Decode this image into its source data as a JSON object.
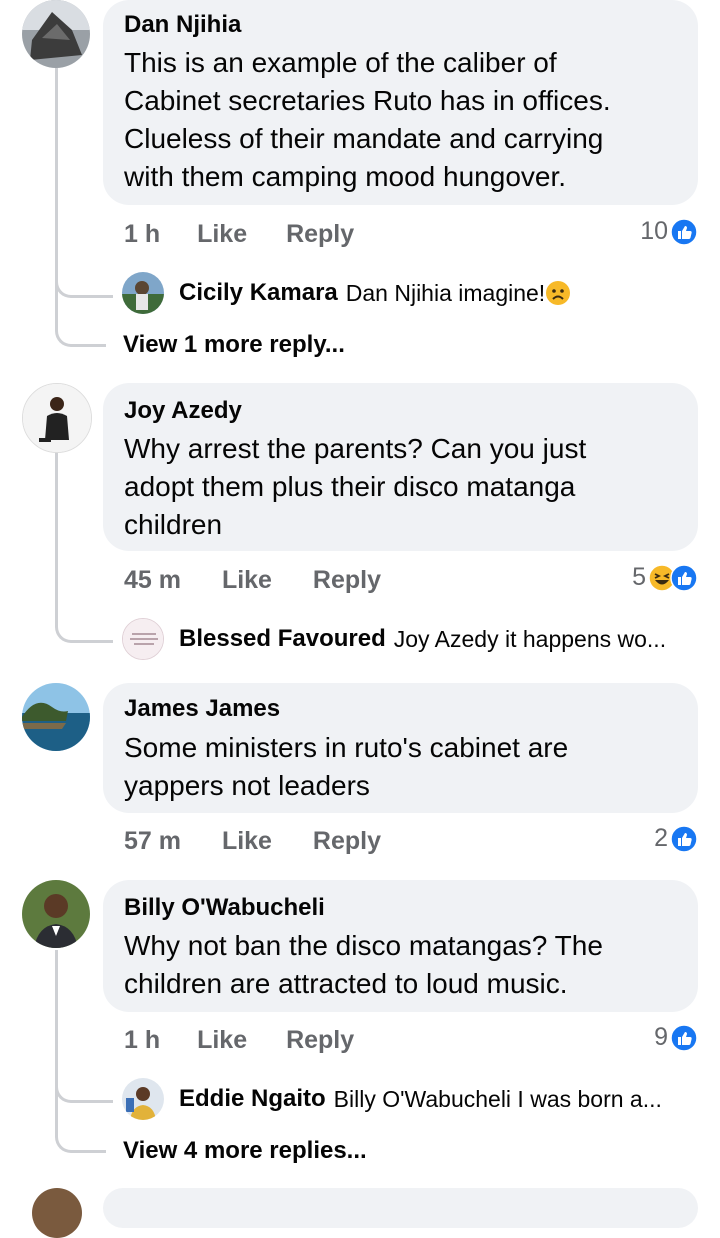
{
  "comments": [
    {
      "author": "Dan Njihia",
      "lines": [
        "This is an example of the caliber of",
        "Cabinet secretaries Ruto has in offices.",
        "Clueless of their mandate and carrying",
        "with them camping mood hungover."
      ],
      "time": "1 h",
      "like_label": "Like",
      "reply_label": "Reply",
      "reaction_count": "10",
      "reply_preview": {
        "author": "Cicily Kamara",
        "text": "Dan Njihia imagine!"
      },
      "more_replies": "View 1 more reply..."
    },
    {
      "author": "Joy Azedy",
      "lines": [
        "Why arrest the parents? Can you just",
        "adopt them plus their disco matanga",
        "children"
      ],
      "time": "45 m",
      "like_label": "Like",
      "reply_label": "Reply",
      "reaction_count": "5",
      "reply_preview": {
        "author": "Blessed Favoured",
        "text": "Joy Azedy it happens wo..."
      }
    },
    {
      "author": "James James",
      "lines": [
        "Some ministers in ruto's cabinet are",
        "yappers not leaders"
      ],
      "time": "57 m",
      "like_label": "Like",
      "reply_label": "Reply",
      "reaction_count": "2"
    },
    {
      "author": "Billy O'Wabucheli",
      "lines": [
        "Why not ban the disco matangas? The",
        "children are attracted to loud music."
      ],
      "time": "1 h",
      "like_label": "Like",
      "reply_label": "Reply",
      "reaction_count": "9",
      "reply_preview": {
        "author": "Eddie Ngaito",
        "text": "Billy O'Wabucheli I was born a..."
      },
      "more_replies": "View 4 more replies..."
    }
  ],
  "colors": {
    "bubble": "#f0f2f5",
    "meta": "#65676b",
    "like_blue": "#1877f2",
    "haha_yellow": "#f7b928",
    "thread_line": "#ced0d4"
  },
  "icons": {
    "like": "like-reaction-icon",
    "haha": "haha-reaction-icon",
    "sad": "sad-emoji-icon"
  }
}
